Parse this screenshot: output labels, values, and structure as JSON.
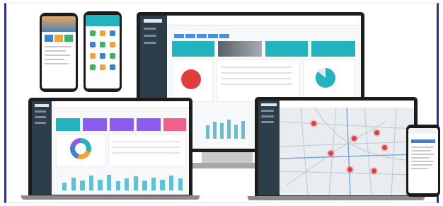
{
  "scene": {
    "description_devices": [
      "phone-left",
      "phone-mid",
      "desktop-monitor",
      "laptop-left",
      "laptop-right",
      "phone-right"
    ]
  },
  "colors": {
    "border": "#2a2f8f",
    "sidebar": "#2d3e4a",
    "teal": "#22b3bf",
    "purple": "#8c5cf0",
    "pink": "#f0608a",
    "red": "#e23d3d",
    "gray": "#8d9199",
    "map": "#e9edf0"
  },
  "desktop": {
    "cards": [
      "teal",
      "gray",
      "teal",
      "teal"
    ],
    "bars": [
      0.55,
      0.7,
      0.65,
      0.8,
      0.6,
      0.75
    ]
  },
  "laptop_left": {
    "cards": [
      "teal",
      "purple",
      "purple",
      "purple",
      "pink"
    ],
    "bars": [
      0.4,
      0.65,
      0.5,
      0.75,
      0.55,
      0.8,
      0.45,
      0.6,
      0.7,
      0.5,
      0.65,
      0.55,
      0.75,
      0.6
    ]
  },
  "laptop_right": {
    "markers": [
      [
        0.25,
        0.18
      ],
      [
        0.72,
        0.28
      ],
      [
        0.55,
        0.35
      ],
      [
        0.78,
        0.45
      ],
      [
        0.38,
        0.52
      ],
      [
        0.52,
        0.7
      ],
      [
        0.7,
        0.72
      ]
    ]
  }
}
